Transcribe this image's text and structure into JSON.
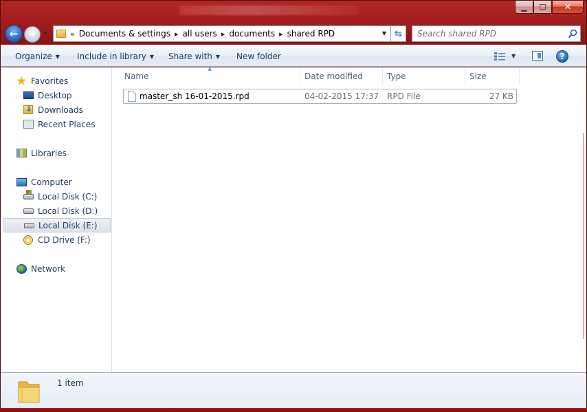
{
  "window": {
    "caption_buttons": {
      "minimize": "▁",
      "maximize": "☐",
      "close": "✕"
    }
  },
  "nav": {
    "back_glyph": "←",
    "forward_glyph": "→",
    "breadcrumb": [
      {
        "label": "Documents & settings"
      },
      {
        "label": "all users"
      },
      {
        "label": "documents"
      },
      {
        "label": "shared RPD"
      }
    ],
    "overflow_glyph": "«",
    "separator_glyph": "▸",
    "refresh_glyph": "⇆",
    "search_placeholder": "Search shared RPD"
  },
  "toolbar": {
    "organize": "Organize",
    "include_in_library": "Include in library",
    "share_with": "Share with",
    "new_folder": "New folder",
    "help_glyph": "?"
  },
  "sidebar": {
    "favorites": "Favorites",
    "desktop": "Desktop",
    "downloads": "Downloads",
    "recent_places": "Recent Places",
    "libraries": "Libraries",
    "computer": "Computer",
    "local_c": "Local Disk (C:)",
    "local_d": "Local Disk (D:)",
    "local_e": "Local Disk (E:)",
    "cd_drive": "CD Drive (F:)",
    "network": "Network"
  },
  "columns": {
    "name": "Name",
    "date_modified": "Date modified",
    "type": "Type",
    "size": "Size"
  },
  "files": [
    {
      "name": "master_sh 16-01-2015.rpd",
      "date_modified": "04-02-2015 17:37",
      "type": "RPD File",
      "size": "27 KB"
    }
  ],
  "details": {
    "item_count": "1 item"
  },
  "colors": {
    "frame": "#a41d1d",
    "accent_text": "#1e395b"
  }
}
